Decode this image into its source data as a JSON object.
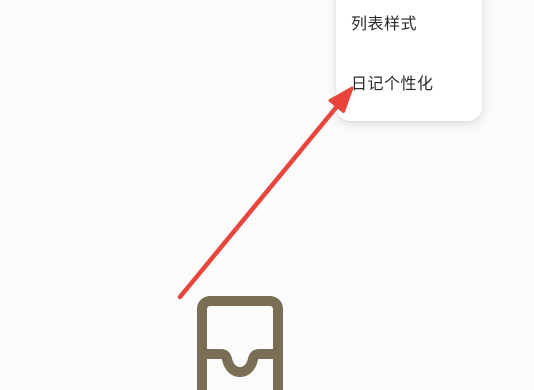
{
  "menu": {
    "items": [
      {
        "label": "列表样式"
      },
      {
        "label": "日记个性化"
      }
    ]
  },
  "icons": {
    "empty_state": "inbox-tray-icon",
    "annotation": "red-arrow-pointer"
  },
  "colors": {
    "background": "#fbfbfb",
    "menu_background": "#ffffff",
    "menu_text": "#2a2a2a",
    "arrow": "#e8453c",
    "inbox_icon": "#7a6e55"
  }
}
